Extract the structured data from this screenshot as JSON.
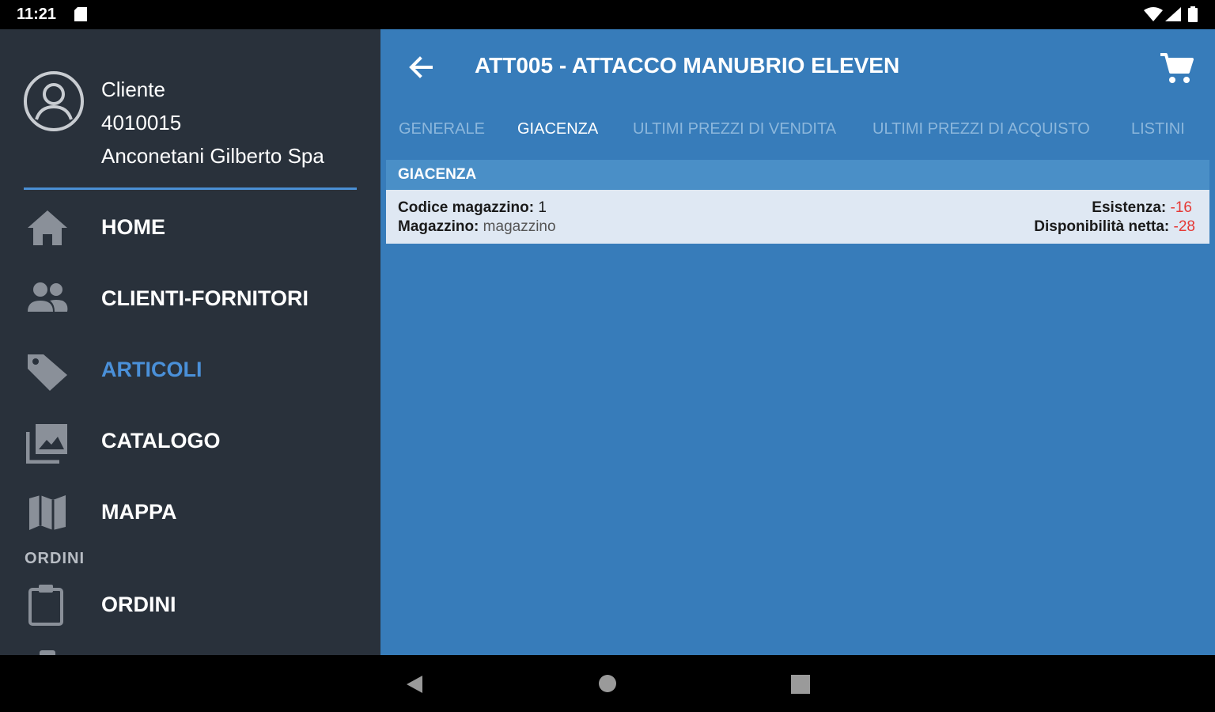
{
  "status_bar": {
    "time": "11:21"
  },
  "drawer": {
    "account": {
      "line1": "Cliente",
      "line2": "4010015",
      "line3": "Anconetani Gilberto Spa"
    },
    "items": [
      {
        "label": "HOME",
        "icon": "home-icon",
        "active": false
      },
      {
        "label": "CLIENTI-FORNITORI",
        "icon": "people-icon",
        "active": false
      },
      {
        "label": "ARTICOLI",
        "icon": "tag-icon",
        "active": true
      },
      {
        "label": "CATALOGO",
        "icon": "gallery-icon",
        "active": false
      },
      {
        "label": "MAPPA",
        "icon": "map-icon",
        "active": false
      },
      {
        "label": "ORDINI",
        "icon": "clipboard-icon",
        "active": false
      }
    ],
    "section_ordini": "ORDINI"
  },
  "header": {
    "title": "ATT005 - ATTACCO MANUBRIO ELEVEN"
  },
  "tabs": [
    {
      "label": "GENERALE",
      "active": false
    },
    {
      "label": "GIACENZA",
      "active": true
    },
    {
      "label": "ULTIMI PREZZI DI VENDITA",
      "active": false
    },
    {
      "label": "ULTIMI PREZZI DI ACQUISTO",
      "active": false
    },
    {
      "label": "LISTINI",
      "active": false
    }
  ],
  "stock": {
    "section_title": "GIACENZA",
    "codice_label": "Codice magazzino:",
    "codice_value": "1",
    "magazzino_label": "Magazzino:",
    "magazzino_value": "magazzino",
    "esistenza_label": "Esistenza:",
    "esistenza_value": "-16",
    "disponibilita_label": "Disponibilità netta:",
    "disponibilita_value": "-28"
  },
  "colors": {
    "drawer_bg": "#29313b",
    "main_bg": "#377cba",
    "accent": "#4a90d9",
    "negative": "#e53935"
  }
}
